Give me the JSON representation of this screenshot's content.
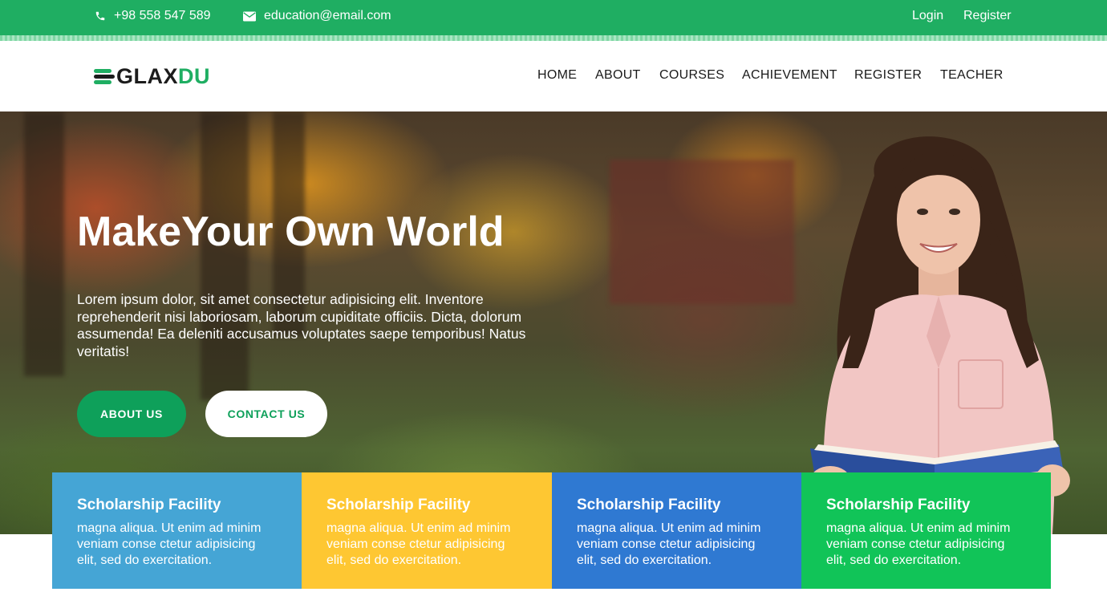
{
  "topbar": {
    "phone": "+98 558 547 589",
    "email": "education@email.com",
    "login": "Login",
    "register": "Register",
    "color": "#1fae62"
  },
  "header": {
    "logo_part1": "GLAX",
    "logo_part2": "DU",
    "nav": [
      "HOME",
      "ABOUT",
      "COURSES",
      "ACHIEVEMENT",
      "REGISTER",
      "TEACHER"
    ]
  },
  "hero": {
    "title": "MakeYour Own World",
    "text": "Lorem ipsum dolor, sit amet consectetur adipisicing elit. Inventore reprehenderit nisi laboriosam, laborum cupiditate officiis. Dicta, dolorum assumenda! Ea deleniti accusamus voluptates saepe temporibus! Natus veritatis!",
    "about_button": "ABOUT US",
    "contact_button": "CONTACT US"
  },
  "cards": [
    {
      "title": "Scholarship Facility",
      "text": "magna aliqua. Ut enim ad minim veniam conse ctetur adipisicing elit, sed do exercitation.",
      "color": "#45a5d5"
    },
    {
      "title": "Scholarship Facility",
      "text": "magna aliqua. Ut enim ad minim veniam conse ctetur adipisicing elit, sed do exercitation.",
      "color": "#fec732"
    },
    {
      "title": "Scholarship Facility",
      "text": "magna aliqua. Ut enim ad minim veniam conse ctetur adipisicing elit, sed do exercitation.",
      "color": "#2f79d2"
    },
    {
      "title": "Scholarship Facility",
      "text": "magna aliqua. Ut enim ad minim veniam conse ctetur adipisicing elit, sed do exercitation.",
      "color": "#11c458"
    }
  ]
}
